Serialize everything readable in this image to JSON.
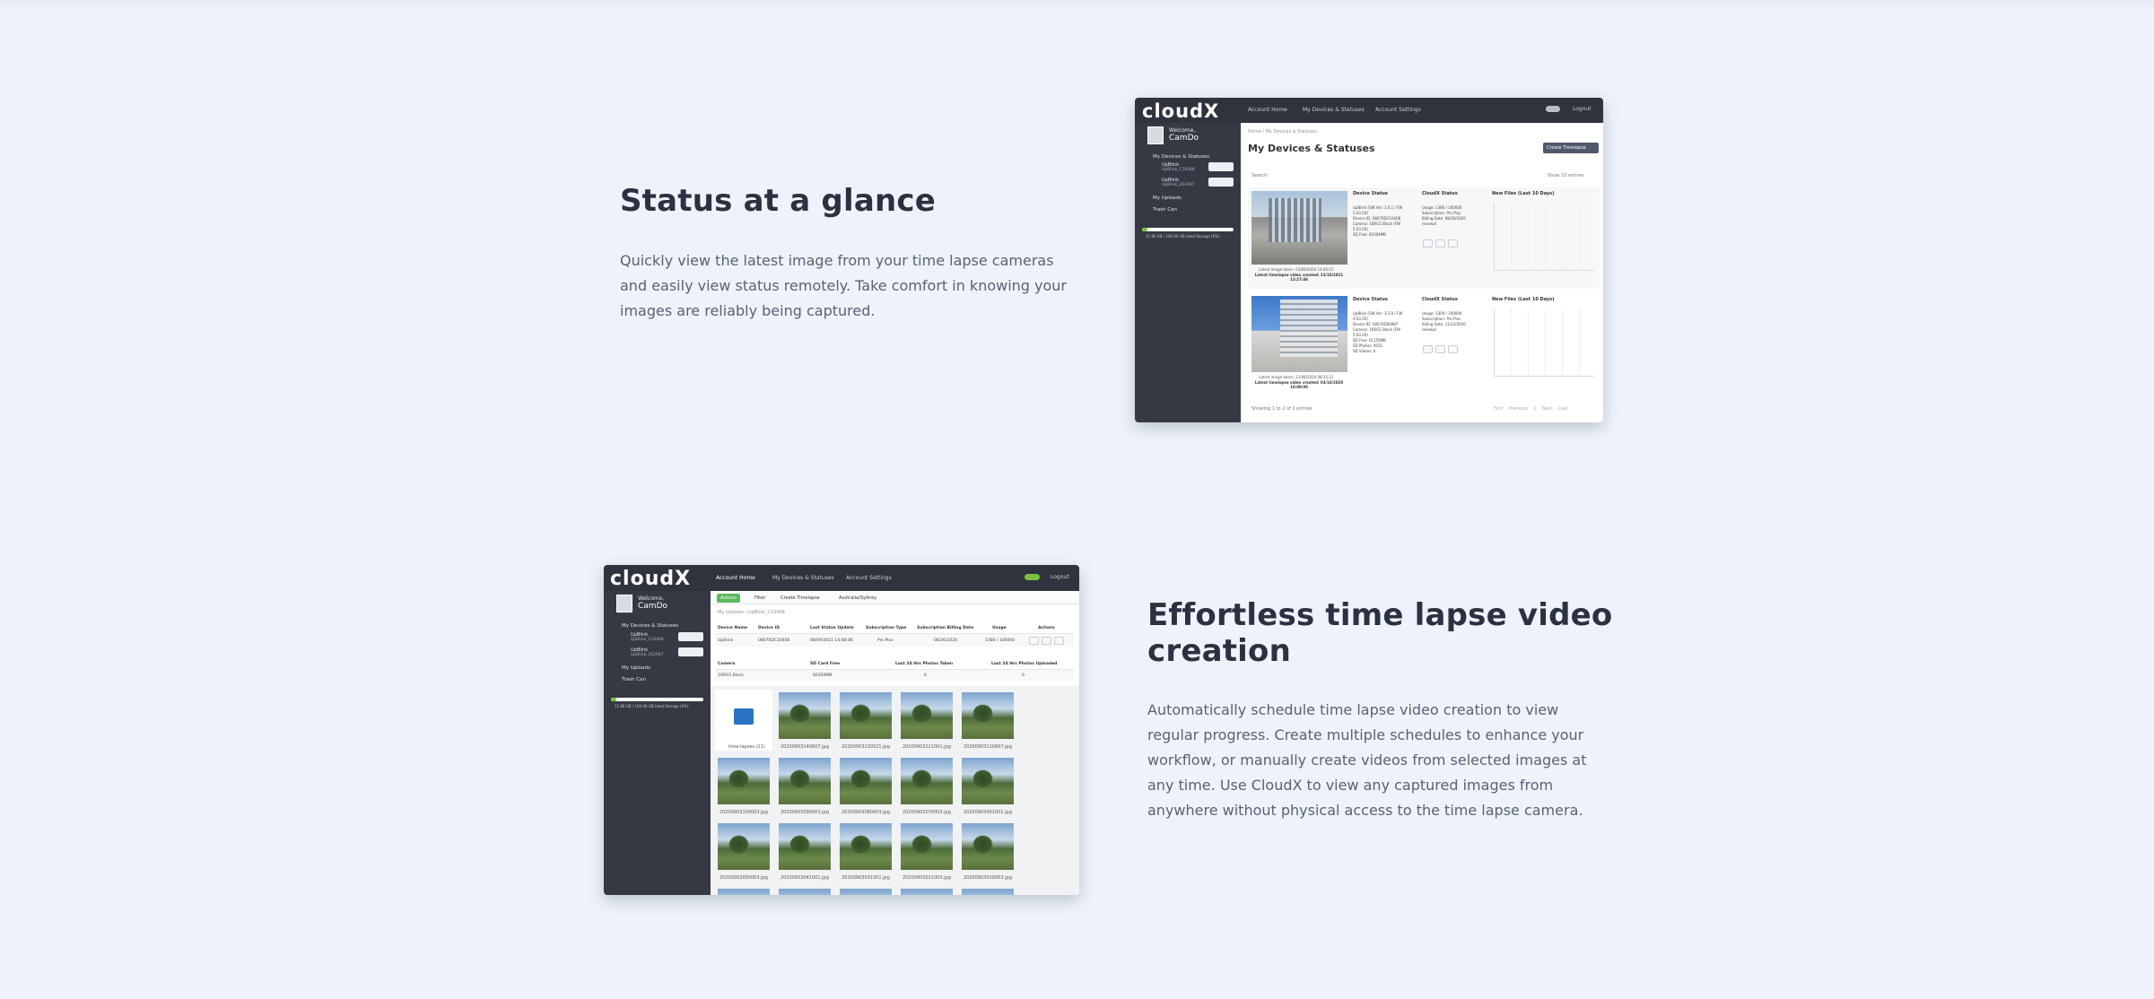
{
  "section1": {
    "heading": "Status at a glance",
    "text": "Quickly view the latest image from your time lapse cameras and easily view status remotely. Take comfort in knowing your images are reliably being captured."
  },
  "section2": {
    "heading": "Effortless time lapse video creation",
    "text": "Automatically schedule time lapse video creation to view regular progress. Create multiple schedules to enhance your workflow, or manually create videos from selected images at any time. Use CloudX to view any captured images from anywhere without physical access to the time lapse camera."
  },
  "app": {
    "logo": "cloudX",
    "nav": [
      "Account Home",
      "My Devices & Statuses",
      "Account Settings"
    ],
    "logout": "Logout",
    "welcome": "Welcome,",
    "username": "CamDo",
    "sidebar": {
      "devices": "My Devices & Statuses",
      "device1_name": "UpBlink",
      "device1_id": "UpBlink_C10408",
      "device2_name": "UpBlink",
      "device2_id": "UpBlink_262987",
      "uploads": "My Uploads",
      "trash": "Trash Can",
      "storage": "11.80 GB / 100.00 GB Used Storage (6%)"
    }
  },
  "shot1": {
    "breadcrumb": "Home / My Devices & Statuses",
    "page_title": "My Devices & Statuses",
    "create_button": "Create Timelapse",
    "search_label": "Search:",
    "show_label": "Show",
    "show_value": "10",
    "entries_label": "entries",
    "col_device_status": "Device Status",
    "col_cloudx_status": "CloudX Status",
    "col_new_files": "New Files (Last 10 Days)",
    "row1": {
      "status_lines": [
        "UpBlink [SW Ver: 1.0.1 / FW",
        "5.03.20]",
        "Device ID: 08070DC10408",
        "Camera: 16RG5 Black (FW",
        "5.03.20)",
        "SD Free: 60304MB"
      ],
      "cloud_lines": [
        "Usage: 1386 / 100000",
        "Subscription: Pro Plus",
        "Billing Date: 08/26/2020",
        "renewal"
      ],
      "latest_image": "Latest image taken: 03/09/2020 14:06:07",
      "latest_video": "Latest timelapse video created: 23/10/2021 13:27:46"
    },
    "row2": {
      "status_lines": [
        "UpBlink [SW Ver: 3.3.0 / FW",
        "4.03.20]",
        "Device ID: 08070DE0987",
        "Camera: 16RG5 Black (FW",
        "5.03.20)",
        "SD Free: 61159MB",
        "SD Photos: 4031",
        "SD Videos: 0"
      ],
      "cloud_lines": [
        "Usage: 3300 / 100000",
        "Subscription: Pro Plus",
        "Billing Date: 11/22/2020",
        "renewal"
      ],
      "latest_image": "Latest image taken: 21/08/2020 08:35:21",
      "latest_video": "Latest timelapse video created: 03/10/2020 10:09:00"
    },
    "showing": "Showing 1 to 2 of 2 entries",
    "pagination": [
      "First",
      "Previous",
      "1",
      "Next",
      "Last"
    ]
  },
  "shot2": {
    "actions_btn": "Actions",
    "filter_btn": "Filter",
    "create_btn": "Create Timelapse",
    "timezone_btn": "Australia/Sydney",
    "breadcrumb": "My Uploads / UpBlink_C10408",
    "table1_headers": [
      "Device Name",
      "Device ID",
      "Last Status Update",
      "Subscription Type",
      "Subscription Billing Date",
      "Usage",
      "Actions"
    ],
    "table1_row": [
      "UpBlink",
      "08070DC10408",
      "08/09/2021 14:08:06",
      "Pro Plus",
      "08/26/2020",
      "1386 / 100000"
    ],
    "table2_headers": [
      "Camera",
      "SD Card Free",
      "Last 24 Hrs Photos Taken",
      "Last 24 Hrs Photos Uploaded"
    ],
    "table2_row": [
      "16RG5 Black",
      "60304MB",
      "0",
      "0"
    ],
    "folder_label": "time-lapses (21)",
    "thumbs_row1": [
      "20200903140607.jpg",
      "20200903130521.jpg",
      "20200903121001.jpg",
      "20200903110607.jpg"
    ],
    "thumbs_row2": [
      "20200903100003.jpg",
      "20200903090003.jpg",
      "20200903080003.jpg",
      "20200903070003.jpg",
      "20200903061001.jpg"
    ],
    "thumbs_row3": [
      "20200903050003.jpg",
      "20200903041001.jpg",
      "20200903031001.jpg",
      "20200903021003.jpg",
      "20200903010003.jpg"
    ]
  }
}
